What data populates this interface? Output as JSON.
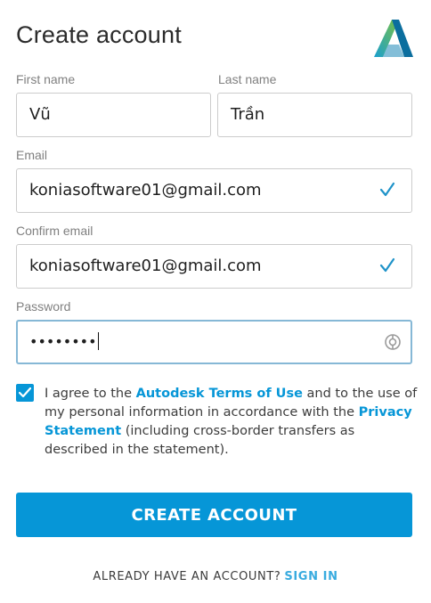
{
  "header": {
    "title": "Create account",
    "logo_icon": "autodesk-logo-icon"
  },
  "form": {
    "first_name": {
      "label": "First name",
      "value": "Vũ"
    },
    "last_name": {
      "label": "Last name",
      "value": "Trần"
    },
    "email": {
      "label": "Email",
      "value": "koniasoftware01@gmail.com",
      "status_icon": "check-icon"
    },
    "confirm_email": {
      "label": "Confirm email",
      "value": "koniasoftware01@gmail.com",
      "status_icon": "check-icon"
    },
    "password": {
      "label": "Password",
      "masked_value": "••••••••",
      "toggle_icon": "show-password-icon"
    }
  },
  "agreement": {
    "checked": true,
    "text_1": "I agree to the ",
    "terms_link": "Autodesk Terms of Use",
    "text_2": " and to the use of my personal information in accordance with the ",
    "privacy_link": "Privacy Statement",
    "text_3": " (including cross-border transfers as described in the statement)."
  },
  "actions": {
    "create_label": "CREATE ACCOUNT",
    "signin_prompt": "ALREADY HAVE AN ACCOUNT?",
    "signin_label": "SIGN IN"
  },
  "colors": {
    "accent": "#0696d7",
    "check": "#1f93c9",
    "link_light": "#38abdf"
  }
}
